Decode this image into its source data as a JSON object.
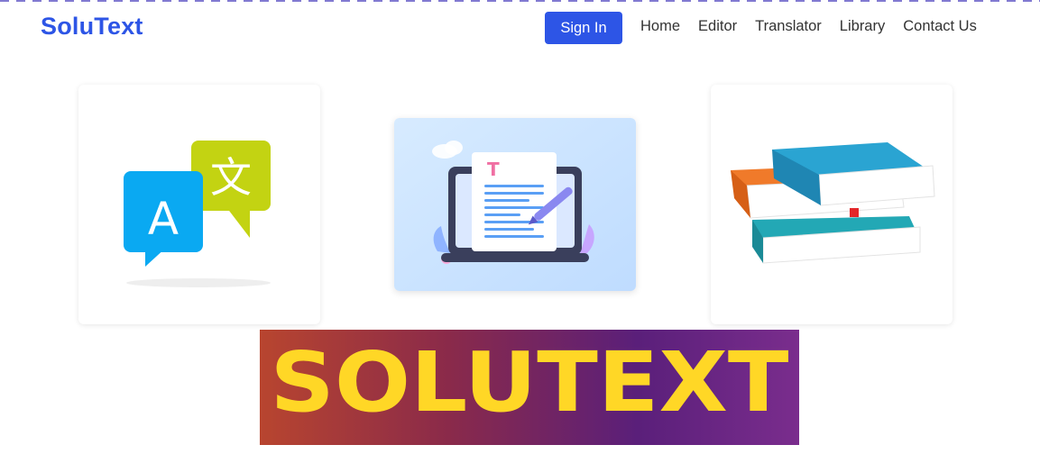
{
  "navbar": {
    "brand": "SoluText",
    "sign_in_label": "Sign In",
    "links": [
      "Home",
      "Editor",
      "Translator",
      "Library",
      "Contact Us"
    ],
    "brand_color": "#2d55e6",
    "accent_color": "#2d55e6"
  },
  "cards": [
    {
      "icon": "translate-icon"
    },
    {
      "icon": "text-editor-laptop-icon"
    },
    {
      "icon": "books-library-icon"
    }
  ],
  "translate_card": {
    "letter_a": "A",
    "letter_zh": "文"
  },
  "editor_card": {
    "letter": "T"
  },
  "banner": {
    "text": "SOLUTEXT",
    "text_color": "#ffd726"
  }
}
